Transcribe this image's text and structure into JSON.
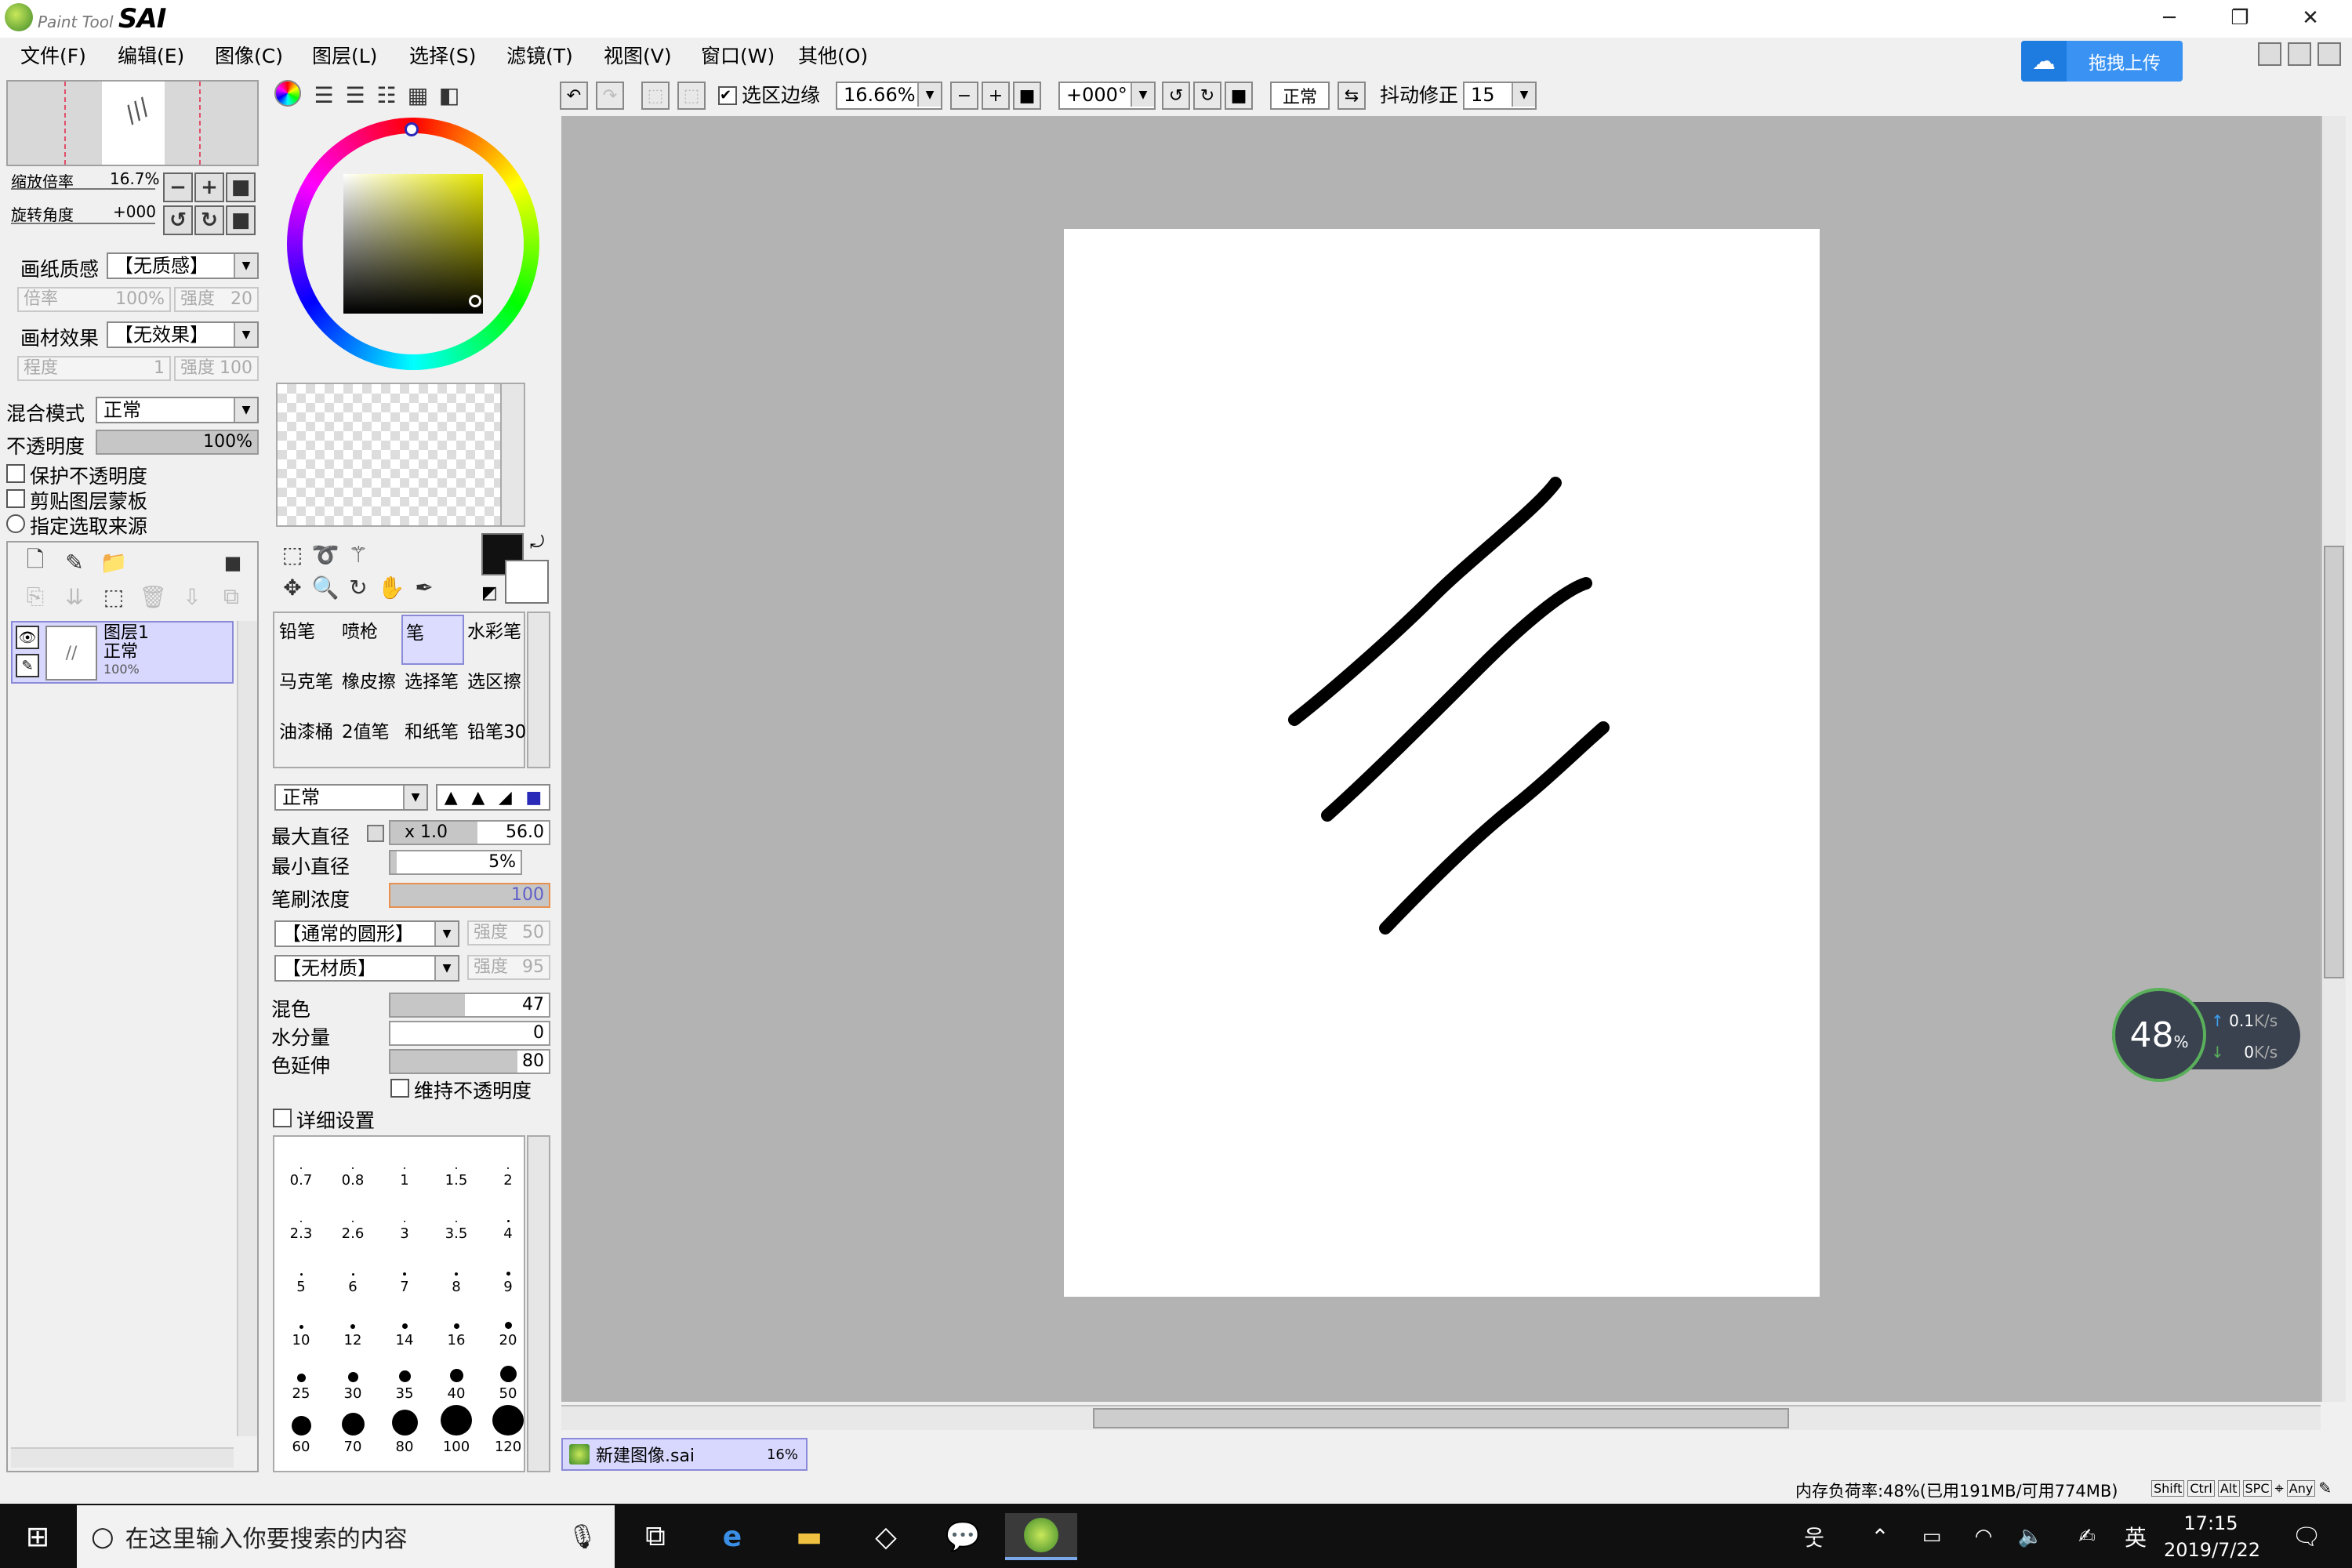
{
  "app": {
    "brand_small": "Paint Tool",
    "brand_big": "SAI"
  },
  "window_controls": {
    "minimize": "─",
    "restore": "❐",
    "close": "✕"
  },
  "menu": [
    "文件(F)",
    "编辑(E)",
    "图像(C)",
    "图层(L)",
    "选择(S)",
    "滤镜(T)",
    "视图(V)",
    "窗口(W)",
    "其他(O)"
  ],
  "upload_button": "拖拽上传",
  "navigator": {
    "zoom_label": "缩放倍率",
    "zoom_value": "16.7%",
    "angle_label": "旋转角度",
    "angle_value": "+000"
  },
  "paper": {
    "texture_label": "画纸质感",
    "texture_value": "【无质感】",
    "rate_label": "倍率",
    "rate_value": "100%",
    "strength_label": "强度",
    "strength_value": "20",
    "effect_label": "画材效果",
    "effect_value": "【无效果】",
    "degree_label": "程度",
    "degree_value": "1",
    "strength2_label": "强度",
    "strength2_value": "100"
  },
  "layer_props": {
    "blend_label": "混合模式",
    "blend_value": "正常",
    "opacity_label": "不透明度",
    "opacity_value": "100%",
    "opacity_fraction": 1.0,
    "protect_opacity": "保护不透明度",
    "clip_mask": "剪贴图层蒙板",
    "select_source": "指定选取来源"
  },
  "layer": {
    "name": "图层1",
    "mode": "正常",
    "opacity": "100%"
  },
  "toolbar": {
    "selection_edge": "选区边缘",
    "zoom": "16.66%",
    "angle": "+000°",
    "mode": "正常",
    "stabilizer_label": "抖动修正",
    "stabilizer_value": "15"
  },
  "brushes": [
    [
      "铅笔",
      "喷枪",
      "笔",
      "水彩笔"
    ],
    [
      "马克笔",
      "橡皮擦",
      "选择笔",
      "选区擦"
    ],
    [
      "油漆桶",
      "2值笔",
      "和纸笔",
      "铅笔30"
    ]
  ],
  "brush_props": {
    "mode": "正常",
    "max_size_label": "最大直径",
    "max_size_mult": "x 1.0",
    "max_size_value": "56.0",
    "max_size_fraction": 0.55,
    "min_size_label": "最小直径",
    "min_size_value": "5%",
    "min_size_fraction": 0.05,
    "density_label": "笔刷浓度",
    "density_value": "100",
    "density_fraction": 1.0,
    "shape_value": "【通常的圆形】",
    "shape_strength_label": "强度",
    "shape_strength_value": "50",
    "texture_value": "【无材质】",
    "texture_strength_label": "强度",
    "texture_strength_value": "95",
    "blend_label": "混色",
    "blend_value": "47",
    "blend_fraction": 0.47,
    "water_label": "水分量",
    "water_value": "0",
    "water_fraction": 0,
    "persist_label": "色延伸",
    "persist_value": "80",
    "persist_fraction": 0.8,
    "keep_opacity": "维持不透明度",
    "detail": "详细设置"
  },
  "brush_sizes": [
    "0.7",
    "0.8",
    "1",
    "1.5",
    "2",
    "2.3",
    "2.6",
    "3",
    "3.5",
    "4",
    "5",
    "6",
    "7",
    "8",
    "9",
    "10",
    "12",
    "14",
    "16",
    "20",
    "25",
    "30",
    "35",
    "40",
    "50",
    "60",
    "70",
    "80",
    "100",
    "120"
  ],
  "doc_tab": {
    "name": "新建图像.sai",
    "zoom": "16%"
  },
  "status": {
    "memory": "内存负荷率:48%(已用191MB/可用774MB)",
    "keys": [
      "Shift",
      "Ctrl",
      "Alt",
      "SPC",
      "Any"
    ]
  },
  "net_widget": {
    "percent": "48",
    "unit": "%",
    "up": "0.1",
    "down": "0",
    "rate_unit": "K/s"
  },
  "taskbar": {
    "search_placeholder": "在这里输入你要搜索的内容",
    "ime": "英",
    "time": "17:15",
    "date": "2019/7/22"
  },
  "colors": {
    "accent_blue": "#3a93f3",
    "layer_select": "#d8d8ff",
    "canvas_bg": "#b3b3b3",
    "taskbar": "#101010"
  }
}
